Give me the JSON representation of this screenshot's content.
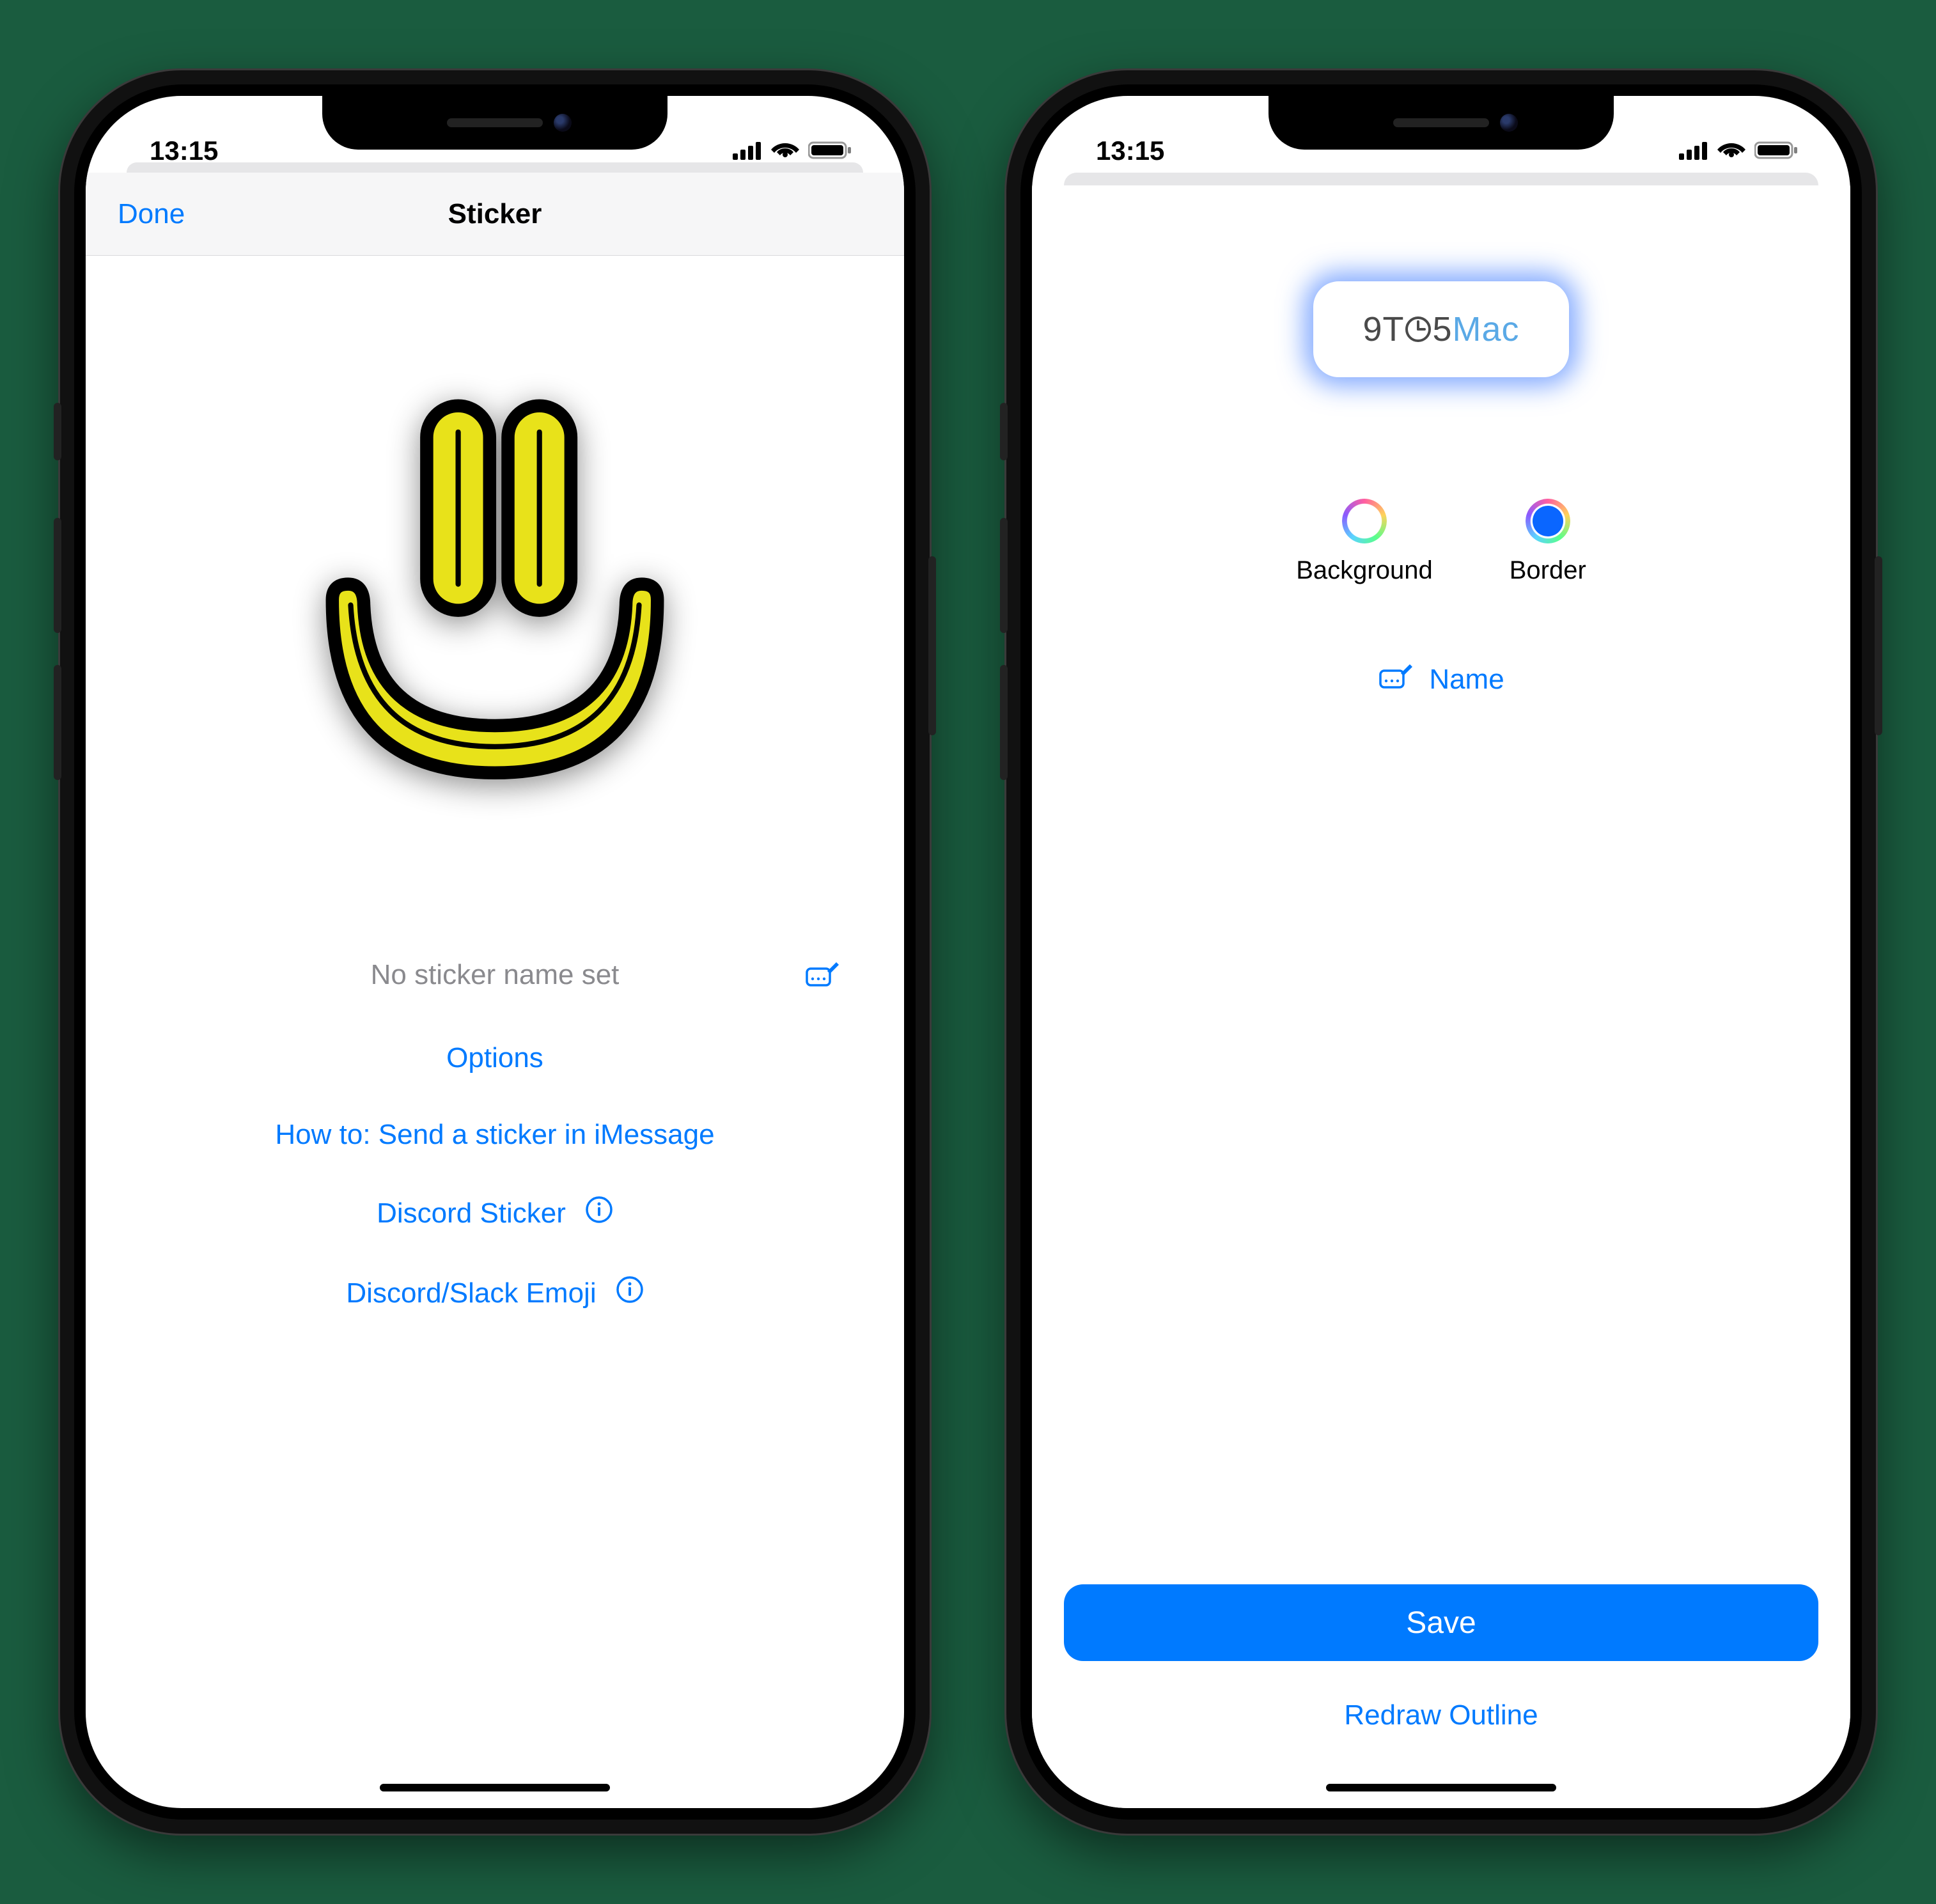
{
  "phone1": {
    "status": {
      "time": "13:15"
    },
    "nav": {
      "done": "Done",
      "title": "Sticker"
    },
    "sticker_name_placeholder": "No sticker name set",
    "links": {
      "options": "Options",
      "howto": "How to: Send a sticker in iMessage",
      "discord_sticker": "Discord Sticker",
      "discord_emoji": "Discord/Slack Emoji"
    }
  },
  "phone2": {
    "status": {
      "time": "13:15"
    },
    "logo": {
      "part1": "9T",
      "part2": "5",
      "part3": "Mac",
      "clock_between": "O"
    },
    "options": {
      "background": "Background",
      "border": "Border"
    },
    "name_action": "Name",
    "save": "Save",
    "redraw": "Redraw Outline"
  }
}
